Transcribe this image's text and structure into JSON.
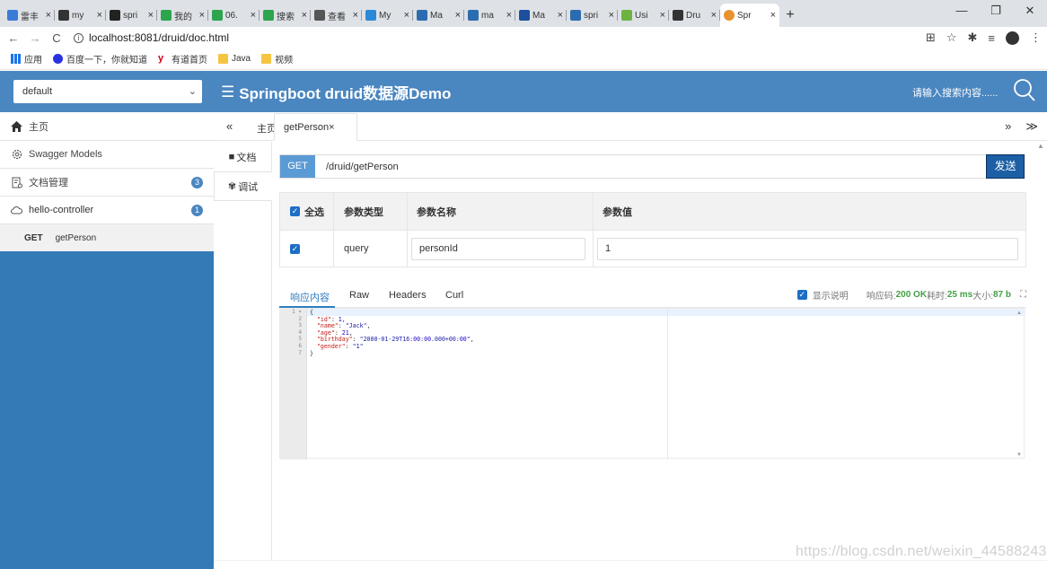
{
  "browser": {
    "tabs": [
      {
        "label": "雷丰",
        "color": "#3b7bd8"
      },
      {
        "label": "my",
        "color": "#333333"
      },
      {
        "label": "spri",
        "color": "#222222"
      },
      {
        "label": "我的",
        "color": "#2da44e"
      },
      {
        "label": "06.",
        "color": "#2da44e"
      },
      {
        "label": "搜索",
        "color": "#2da44e"
      },
      {
        "label": "查看",
        "color": "#555555"
      },
      {
        "label": "My",
        "color": "#2b8ad8"
      },
      {
        "label": "Ma",
        "color": "#2b6cb0"
      },
      {
        "label": "ma",
        "color": "#2b6cb0"
      },
      {
        "label": "Ma",
        "color": "#1c4f9c"
      },
      {
        "label": "spri",
        "color": "#2b6cb0"
      },
      {
        "label": "Usi",
        "color": "#6db33f"
      },
      {
        "label": "Dru",
        "color": "#333333"
      }
    ],
    "active_tab": {
      "label": "Spr",
      "color": "#e8912d"
    },
    "new_tab": "+",
    "window_controls": [
      "—",
      "❐",
      "✕"
    ],
    "url": "localhost:8081/druid/doc.html",
    "bookmarks": [
      {
        "label": "应用",
        "color": "#1a73e8"
      },
      {
        "label": "百度一下，你就知道",
        "color": "#2932e1"
      },
      {
        "label": "有道首页",
        "color": "#d0021b"
      },
      {
        "label": "Java",
        "color": "#f5c542"
      },
      {
        "label": "视频",
        "color": "#f5c542"
      }
    ]
  },
  "header": {
    "project_select": "default",
    "title": "Springboot druid数据源Demo",
    "search_placeholder": "请输入搜索内容......",
    "bg_color": "#4a86c0"
  },
  "sidebar": {
    "home": "主页",
    "models": "Swagger Models",
    "doc_mgmt": "文档管理",
    "doc_mgmt_badge": "3",
    "controller": "hello-controller",
    "controller_badge": "1",
    "api_method": "GET",
    "api_name": "getPerson"
  },
  "main_tabs": {
    "prev": "«",
    "home": "主页",
    "active": "getPerson×",
    "next": "»",
    "more": "≫"
  },
  "left_tabs": {
    "doc": "文档",
    "debug": "调试"
  },
  "request": {
    "method": "GET",
    "path": "/druid/getPerson",
    "send": "发送"
  },
  "params": {
    "headers": [
      "全选",
      "参数类型",
      "参数名称",
      "参数值"
    ],
    "rows": [
      {
        "checked": true,
        "type": "query",
        "name": "personId",
        "value": "1"
      }
    ]
  },
  "response": {
    "tabs": [
      "响应内容",
      "Raw",
      "Headers",
      "Curl"
    ],
    "show_desc": "显示说明",
    "status_label": "响应码:",
    "status_value": "200 OK",
    "time_label": "耗时:",
    "time_value": "25 ms",
    "size_label": "大小:",
    "size_value": "87 b",
    "line_numbers": [
      "1 ▾",
      "2",
      "3",
      "4",
      "5",
      "6",
      "7"
    ],
    "code": [
      "{",
      "  \"id\": 1,",
      "  \"name\": \"Jack\",",
      "  \"age\": 21,",
      "  \"birthday\": \"2000-01-29T16:00:00.000+00:00\",",
      "  \"gender\": \"1\"",
      "}"
    ]
  },
  "watermark": "https://blog.csdn.net/weixin_44588243"
}
